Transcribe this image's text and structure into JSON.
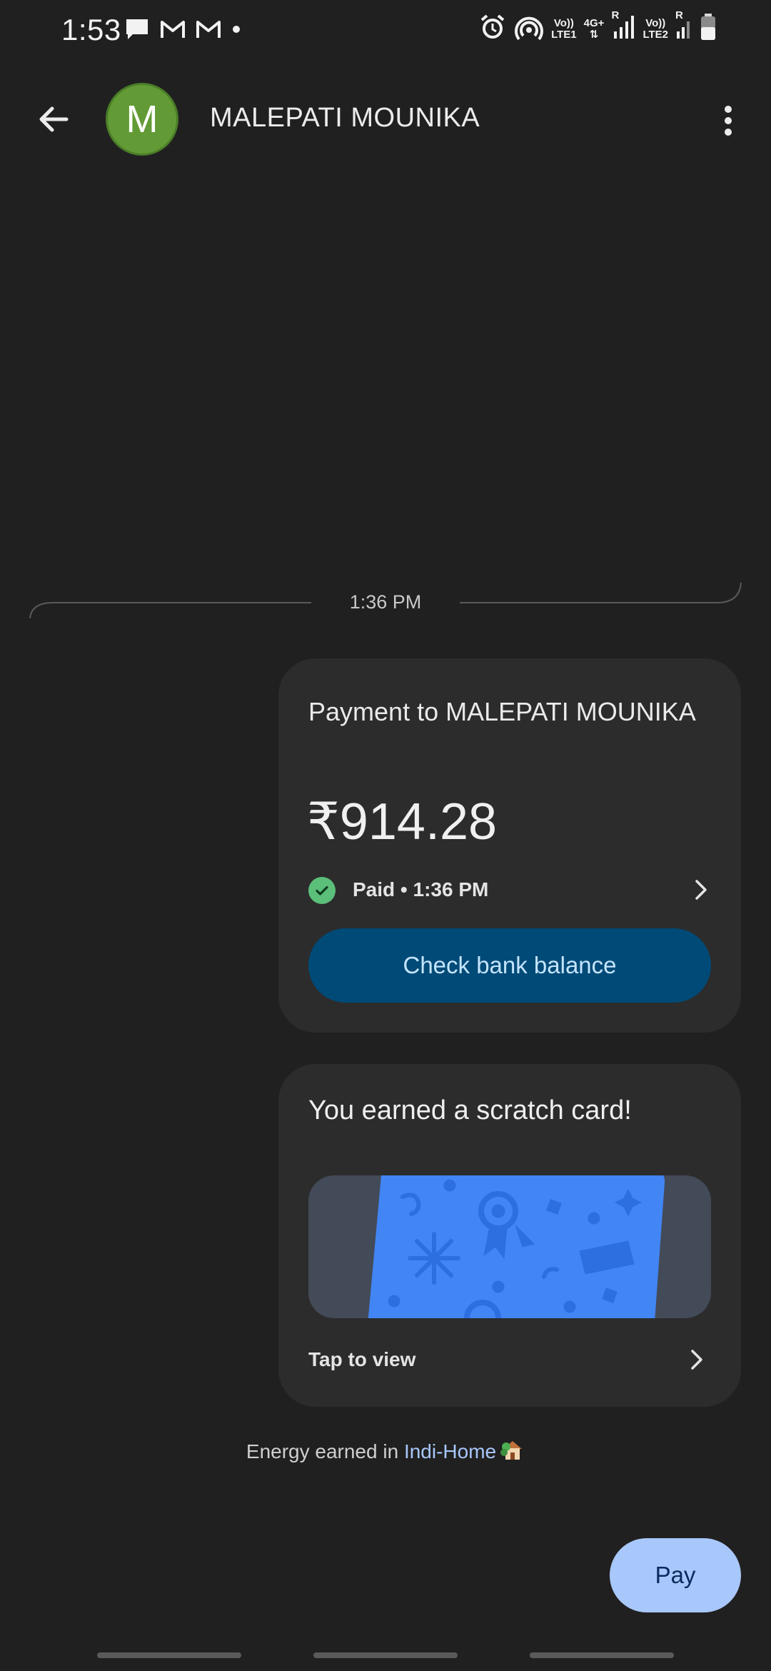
{
  "status_bar": {
    "time": "1:53",
    "net1_top": "Vo))",
    "net1_bottom": "LTE1",
    "net_gen": "4G+",
    "roaming": "R",
    "net2_top": "Vo))",
    "net2_bottom": "LTE2"
  },
  "header": {
    "avatar_letter": "M",
    "contact_name": "MALEPATI MOUNIKA"
  },
  "conversation": {
    "divider_time": "1:36 PM",
    "payment": {
      "title": "Payment to MALEPATI MOUNIKA",
      "amount": "₹914.28",
      "status": "Paid • 1:36 PM",
      "check_balance_label": "Check bank balance"
    },
    "scratch": {
      "title": "You earned a scratch card!",
      "tap_label": "Tap to view"
    },
    "energy": {
      "prefix": "Energy earned in ",
      "link": "Indi-Home"
    }
  },
  "actions": {
    "pay_label": "Pay"
  },
  "colors": {
    "background": "#202020",
    "card": "#2c2c2c",
    "avatar": "#629b36",
    "primary_button": "#004a77",
    "pay_button": "#a8c7fa",
    "paid_green": "#5bbf7a",
    "scratch_blue": "#4285f4"
  }
}
